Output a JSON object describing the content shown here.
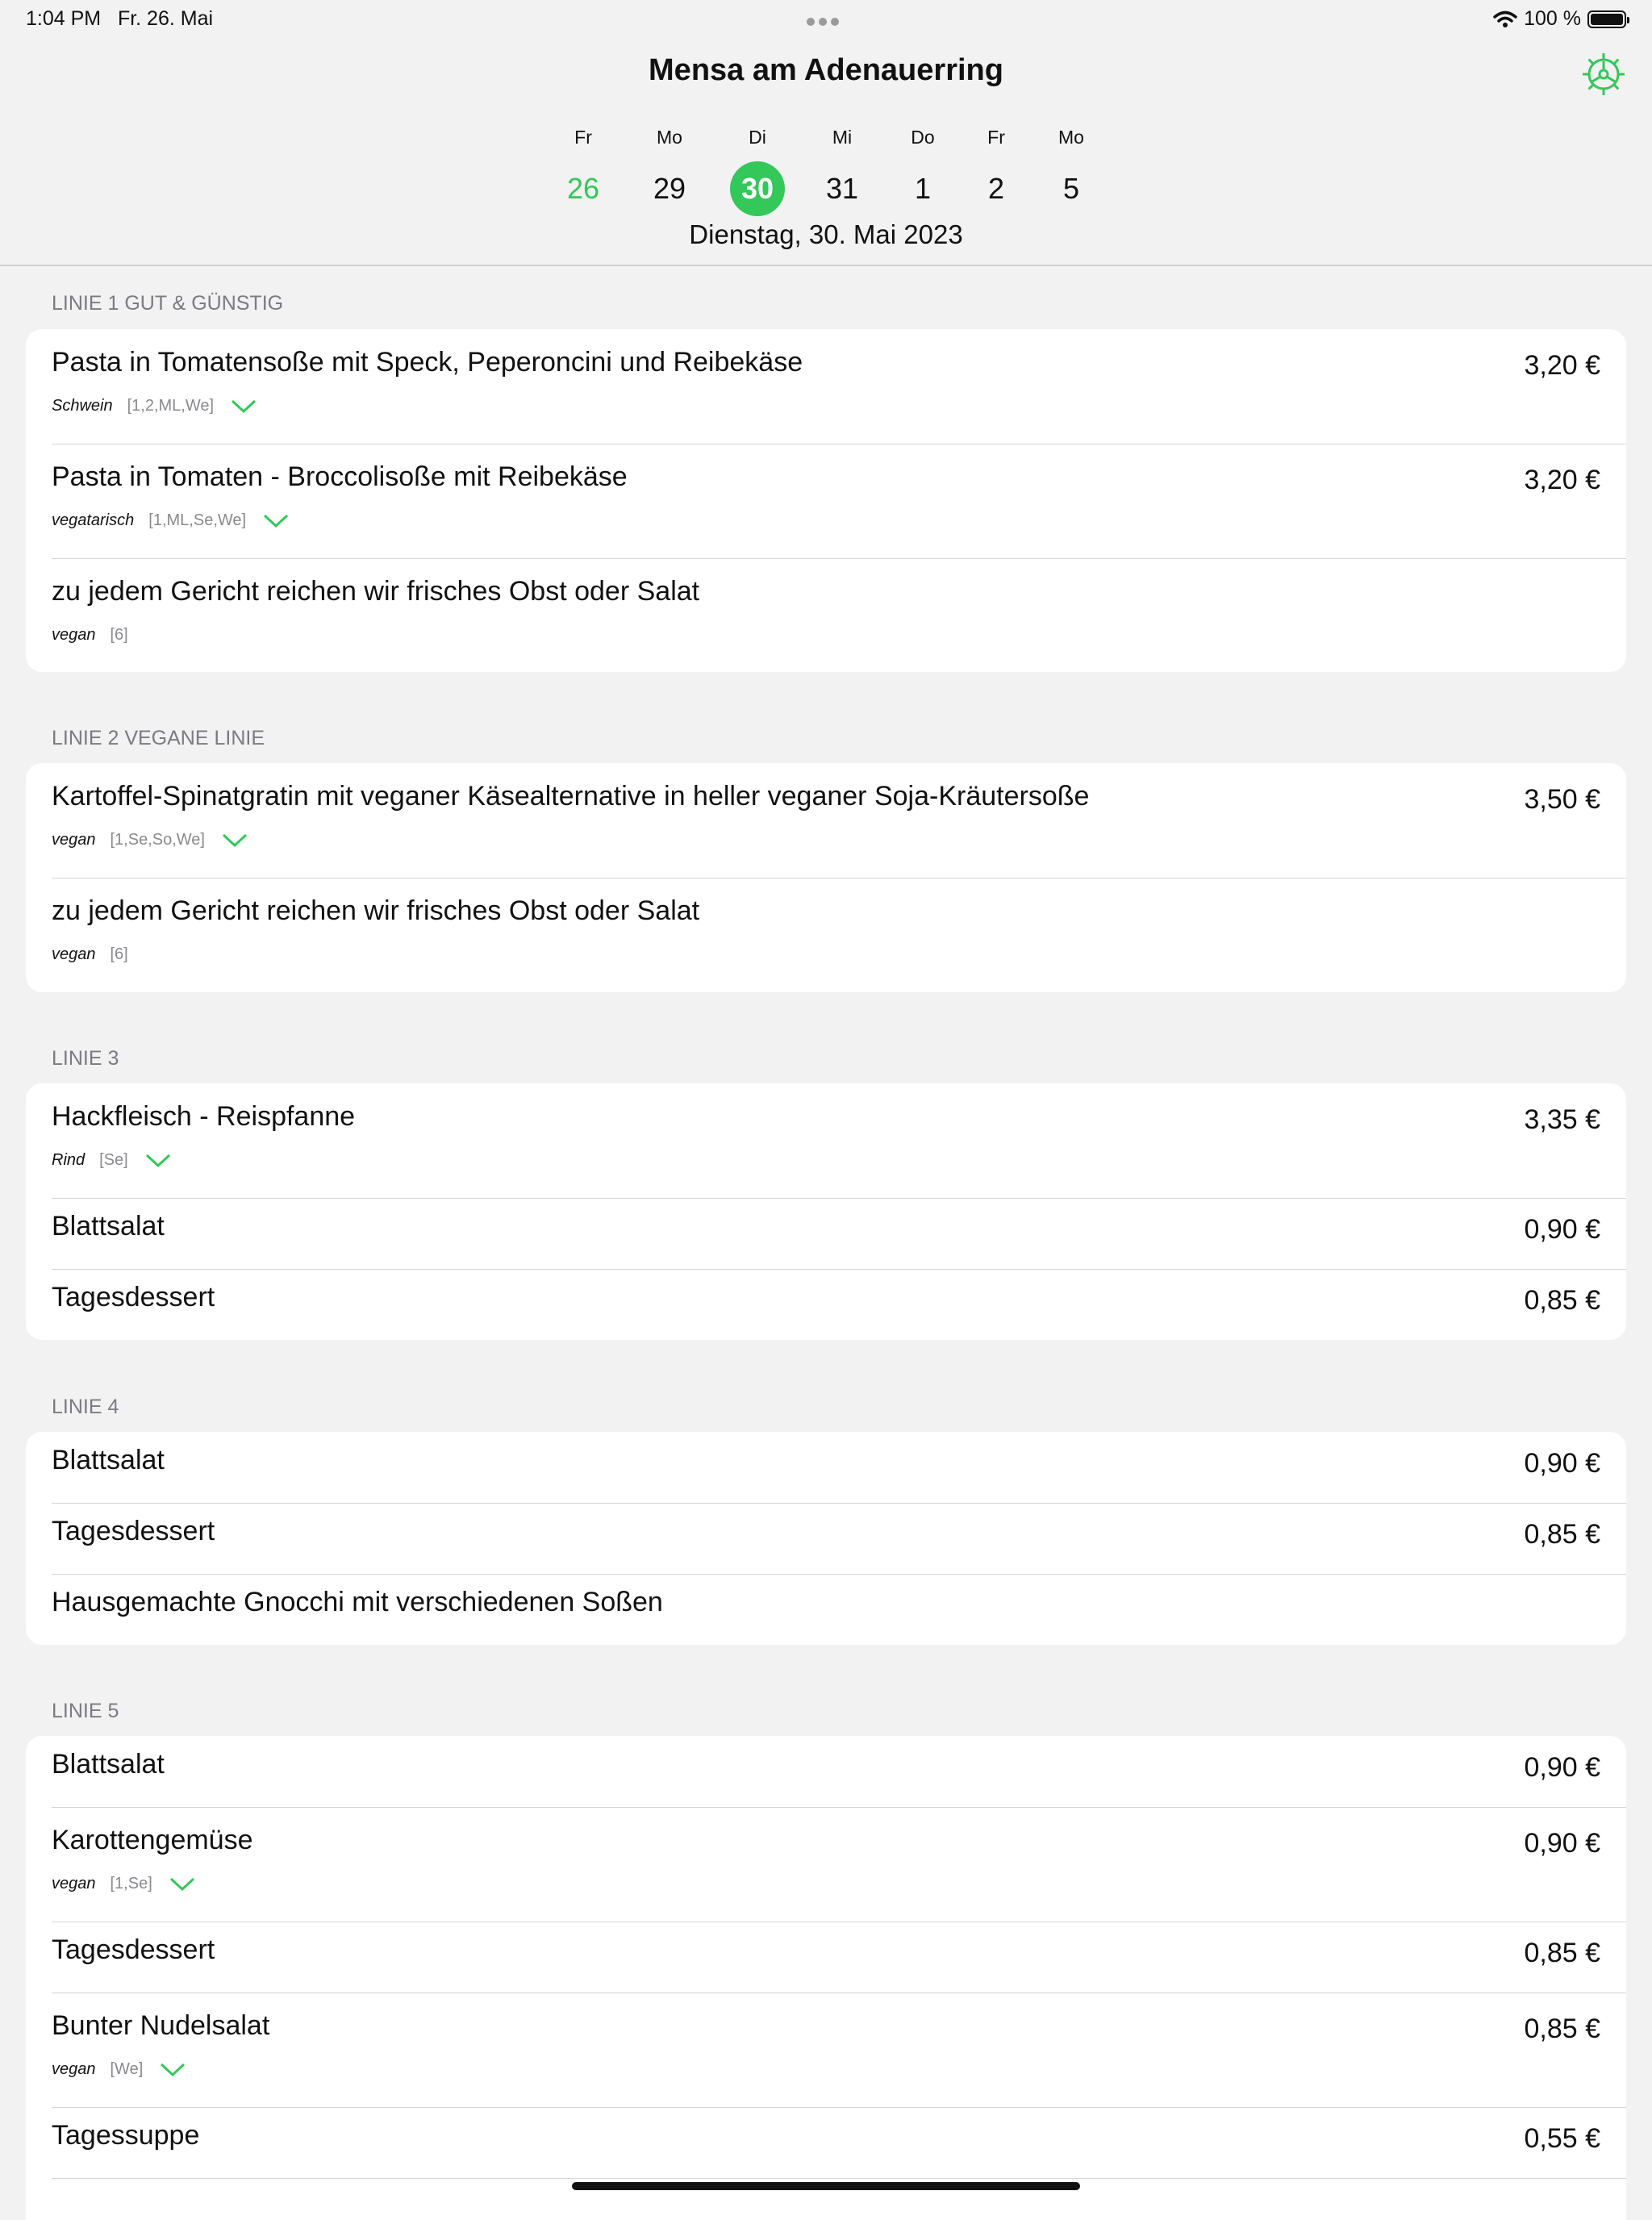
{
  "status_bar": {
    "time": "1:04 PM",
    "date": "Fr. 26. Mai",
    "battery": "100 %",
    "icons": [
      "multitask-dots-icon",
      "wifi-icon",
      "battery-icon"
    ]
  },
  "header": {
    "title": "Mensa am Adenauerring",
    "settings_icon": "gear-icon",
    "accent_color": "#34c759",
    "days": [
      {
        "weekday": "Fr",
        "number": "26",
        "state": "today"
      },
      {
        "weekday": "Mo",
        "number": "29",
        "state": "normal"
      },
      {
        "weekday": "Di",
        "number": "30",
        "state": "selected"
      },
      {
        "weekday": "Mi",
        "number": "31",
        "state": "normal"
      },
      {
        "weekday": "Do",
        "number": "1",
        "state": "normal"
      },
      {
        "weekday": "Fr",
        "number": "2",
        "state": "normal"
      },
      {
        "weekday": "Mo",
        "number": "5",
        "state": "normal"
      }
    ],
    "selected_date": "Dienstag, 30. Mai 2023"
  },
  "sections": [
    {
      "title": "LINIE 1 GUT & GÜNSTIG",
      "items": [
        {
          "name": "Pasta in Tomatensoße mit Speck, Peperoncini und Reibekäse",
          "price": "3,20 €",
          "category": "Schwein",
          "allergens": "[1,2,ML,We]",
          "expandable": true
        },
        {
          "name": "Pasta in Tomaten - Broccolisoße mit Reibekäse",
          "price": "3,20 €",
          "category": "vegatarisch",
          "allergens": "[1,ML,Se,We]",
          "expandable": true
        },
        {
          "name": "zu jedem Gericht reichen wir frisches Obst oder Salat",
          "price": "",
          "category": "vegan",
          "allergens": "[6]",
          "expandable": false
        }
      ]
    },
    {
      "title": "LINIE 2 VEGANE LINIE",
      "items": [
        {
          "name": "Kartoffel-Spinatgratin mit veganer Käsealternative in heller veganer Soja-Kräutersoße",
          "price": "3,50 €",
          "category": "vegan",
          "allergens": "[1,Se,So,We]",
          "expandable": true
        },
        {
          "name": "zu jedem Gericht reichen wir frisches Obst oder Salat",
          "price": "",
          "category": "vegan",
          "allergens": "[6]",
          "expandable": false
        }
      ]
    },
    {
      "title": "LINIE 3",
      "items": [
        {
          "name": "Hackfleisch - Reispfanne",
          "price": "3,35 €",
          "category": "Rind",
          "allergens": "[Se]",
          "expandable": true
        },
        {
          "name": "Blattsalat",
          "price": "0,90 €",
          "category": "",
          "allergens": "",
          "expandable": false
        },
        {
          "name": "Tagesdessert",
          "price": "0,85 €",
          "category": "",
          "allergens": "",
          "expandable": false
        }
      ]
    },
    {
      "title": "LINIE 4",
      "items": [
        {
          "name": "Blattsalat",
          "price": "0,90 €",
          "category": "",
          "allergens": "",
          "expandable": false
        },
        {
          "name": "Tagesdessert",
          "price": "0,85 €",
          "category": "",
          "allergens": "",
          "expandable": false
        },
        {
          "name": "Hausgemachte Gnocchi mit verschiedenen Soßen",
          "price": "",
          "category": "",
          "allergens": "",
          "expandable": false
        }
      ]
    },
    {
      "title": "LINIE 5",
      "items": [
        {
          "name": "Blattsalat",
          "price": "0,90 €",
          "category": "",
          "allergens": "",
          "expandable": false
        },
        {
          "name": "Karottengemüse",
          "price": "0,90 €",
          "category": "vegan",
          "allergens": "[1,Se]",
          "expandable": true
        },
        {
          "name": "Tagesdessert",
          "price": "0,85 €",
          "category": "",
          "allergens": "",
          "expandable": false
        },
        {
          "name": "Bunter Nudelsalat",
          "price": "0,85 €",
          "category": "vegan",
          "allergens": "[We]",
          "expandable": true
        },
        {
          "name": "Tagessuppe",
          "price": "0,55 €",
          "category": "",
          "allergens": "",
          "expandable": false
        }
      ]
    }
  ]
}
